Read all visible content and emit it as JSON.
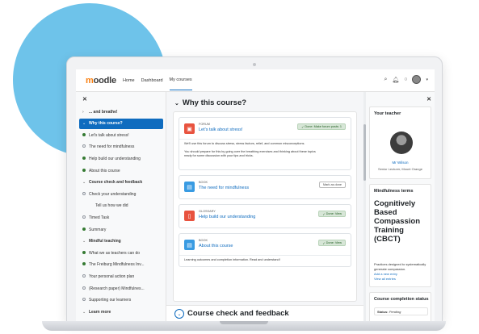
{
  "navbar": {
    "logo": "moodle",
    "links": [
      "Home",
      "Dashboard",
      "My courses"
    ],
    "active_link": "My courses"
  },
  "left_drawer": {
    "items": [
      {
        "label": "... and breathe!",
        "kind": "section-collapsed"
      },
      {
        "label": "Why this course?",
        "kind": "section-active"
      },
      {
        "label": "Let's talk about stress!",
        "kind": "done"
      },
      {
        "label": "The need for mindfulness",
        "kind": "open"
      },
      {
        "label": "Help build our understanding",
        "kind": "done"
      },
      {
        "label": "About this course",
        "kind": "done"
      },
      {
        "label": "Course check and feedback",
        "kind": "section"
      },
      {
        "label": "Check your understanding",
        "kind": "open"
      },
      {
        "label": "Tell us how we did",
        "kind": "plain"
      },
      {
        "label": "Timed Task",
        "kind": "open"
      },
      {
        "label": "Summary",
        "kind": "done"
      },
      {
        "label": "Mindful teaching",
        "kind": "section"
      },
      {
        "label": "What we as teachers can do",
        "kind": "done"
      },
      {
        "label": "The Freiburg Mindfulness Inv...",
        "kind": "done"
      },
      {
        "label": "Your personal action plan",
        "kind": "open"
      },
      {
        "label": "(Research paper) Mindfulnes...",
        "kind": "open"
      },
      {
        "label": "Supporting our learners",
        "kind": "open"
      },
      {
        "label": "Learn more",
        "kind": "section"
      }
    ]
  },
  "main": {
    "section_title": "Why this course?",
    "activities": [
      {
        "type": "FORUM",
        "name": "Let's talk about stress!",
        "badge": "Done: Make forum posts: 1",
        "badge_kind": "done",
        "icon_color": "#e8533f",
        "desc": [
          "We'll use this forum to discuss stress, stress factors, relief, and common misconceptions.",
          "You should prepare for this by going over the breathing exercises and thinking about these topics",
          "ready for some discussion with your tips and tricks."
        ]
      },
      {
        "type": "BOOK",
        "name": "The need for mindfulness",
        "badge": "Mark as done",
        "badge_kind": "mark",
        "icon_color": "#399be2",
        "desc": []
      },
      {
        "type": "GLOSSARY",
        "name": "Help build our understanding",
        "badge": "Done: View",
        "badge_kind": "done",
        "icon_color": "#e8533f",
        "desc": []
      },
      {
        "type": "BOOK",
        "name": "About this course",
        "badge": "Done: View",
        "badge_kind": "done",
        "icon_color": "#399be2",
        "desc": [
          "Learning outcomes and completion information. Read and understand!"
        ]
      }
    ],
    "next_section_title": "Course check and feedback"
  },
  "right_drawer": {
    "teacher_block": {
      "title": "Your teacher",
      "name": "Mr Wilson",
      "role": "Senior Lecturer, Mount Orange"
    },
    "terms_block": {
      "title": "Mindfulness terms",
      "term": "Cognitively Based Compassion Training (CBCT)",
      "definition": "Practices designed to systematically generate compassion.",
      "add_link": "Add a new entry",
      "view_link": "View all entries"
    },
    "completion_block": {
      "title": "Course completion status",
      "status_label": "Status:",
      "status_value": "Pending"
    }
  },
  "colors": {
    "accent": "#0f6cbf",
    "blob": "#6ec3ea",
    "done_dot": "#357a32"
  }
}
